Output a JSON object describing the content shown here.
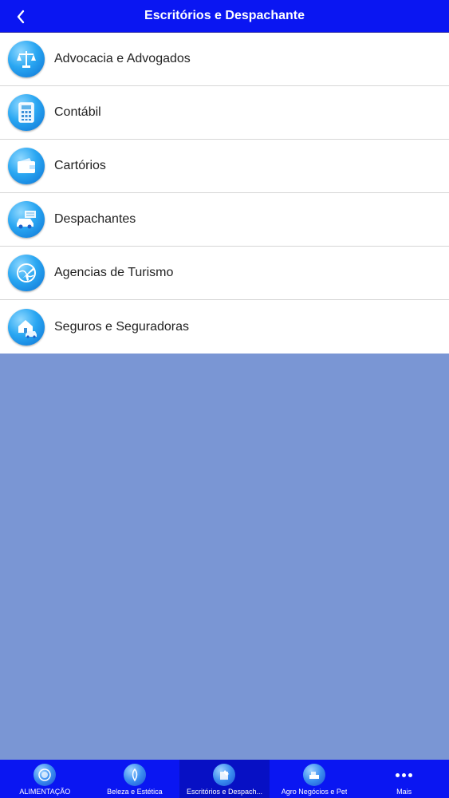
{
  "header": {
    "title": "Escritórios e Despachante",
    "back_icon": "chevron-left-icon"
  },
  "list": {
    "items": [
      {
        "label": "Advocacia e Advogados",
        "icon": "scales-icon"
      },
      {
        "label": "Contábil",
        "icon": "calculator-icon"
      },
      {
        "label": "Cartórios",
        "icon": "wallet-icon"
      },
      {
        "label": "Despachantes",
        "icon": "car-icon"
      },
      {
        "label": "Agencias de Turismo",
        "icon": "airplane-globe-icon"
      },
      {
        "label": "Seguros e Seguradoras",
        "icon": "house-car-icon"
      }
    ]
  },
  "tabbar": {
    "tabs": [
      {
        "label": "ALIMENTAÇÃO",
        "icon": "plate-icon",
        "selected": false
      },
      {
        "label": "Beleza e Estética",
        "icon": "beauty-icon",
        "selected": false
      },
      {
        "label": "Escritórios e Despach...",
        "icon": "office-icon",
        "selected": true
      },
      {
        "label": "Agro Negócios e Pet",
        "icon": "agro-icon",
        "selected": false
      },
      {
        "label": "Mais",
        "icon": "more-icon",
        "selected": false
      }
    ]
  },
  "colors": {
    "nav_bar": "#0a16f2",
    "background": "#7a96d4",
    "row_text": "#222222"
  }
}
